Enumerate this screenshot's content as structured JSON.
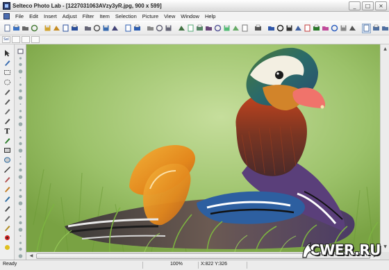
{
  "window": {
    "title": "Selteco Photo Lab - [1227031063AVzy3yR.jpg, 900 x 599]",
    "controls": [
      "_",
      "□",
      "×"
    ]
  },
  "menu": [
    "File",
    "Edit",
    "Insert",
    "Adjust",
    "Filter",
    "Item",
    "Selection",
    "Picture",
    "View",
    "Window",
    "Help"
  ],
  "toolbar": {
    "icons": [
      "new-icon",
      "open-icon",
      "print-icon",
      "print-preview-icon",
      "folder-icon",
      "folder-open-icon",
      "save-icon",
      "save-as-icon",
      "scan-icon",
      "camera-icon",
      "email-icon",
      "zoom-search-icon",
      "undo-icon",
      "redo-icon",
      "cut-icon",
      "copy-icon",
      "paste-icon",
      "crop-icon",
      "resize-icon",
      "rotate-icon",
      "flip-icon",
      "align-icon",
      "distort-icon",
      "transform-icon",
      "mirror-icon",
      "text-icon",
      "brightness-icon",
      "contrast-icon",
      "levels-icon",
      "picture-icon",
      "color-balance-icon",
      "hue-icon",
      "saturation-icon",
      "channels-icon",
      "gradient-icon",
      "effects-icon",
      "zoom-fit-icon",
      "zoom-in-icon",
      "zoom-out-icon"
    ]
  },
  "options": {
    "labels": [
      "Sel",
      "",
      "",
      ""
    ]
  },
  "tools": [
    "pointer-icon",
    "move-icon",
    "rect-select-icon",
    "ellipse-select-icon",
    "lasso-icon",
    "freeform-select-icon",
    "magic-wand-icon",
    "clone-stamp-icon",
    "text-tool-icon",
    "pen-icon",
    "rectangle-icon",
    "ellipse-icon",
    "line-icon",
    "eraser-icon",
    "fill-bucket-icon",
    "zoom-tool-icon",
    "brush-icon",
    "smudge-icon",
    "ruler-icon",
    "red-eye-icon",
    "color-picker-icon"
  ],
  "status": {
    "state": "Ready",
    "zoom": "100%",
    "coords": "X:822  Y:326"
  },
  "watermark": "CWER.RU",
  "colors": {
    "grass": "#8fb75a",
    "duck_orange": "#e08a1e",
    "duck_purple": "#5a3f7a",
    "duck_beak": "#f0736b"
  }
}
